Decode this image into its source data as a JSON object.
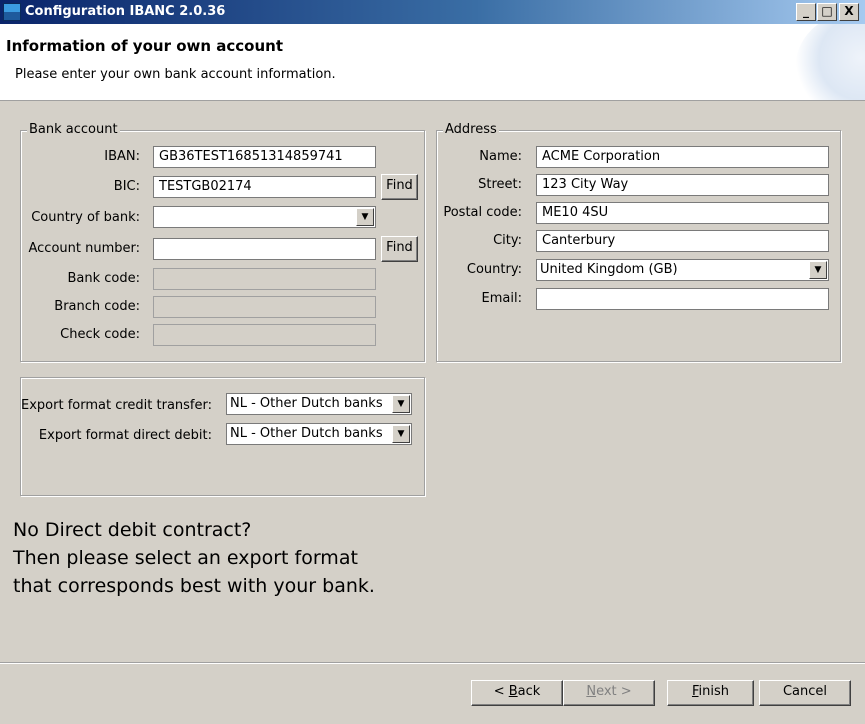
{
  "window": {
    "title": "Configuration IBANC 2.0.36",
    "buttons": {
      "minimize": "_",
      "maximize": "□",
      "close": "X"
    }
  },
  "header": {
    "title": "Information of your own account",
    "subtitle": "Please enter your own bank account information."
  },
  "bank_account": {
    "legend": "Bank account",
    "iban_label": "IBAN:",
    "iban_value": "GB36TEST16851314859741",
    "bic_label": "BIC:",
    "bic_value": "TESTGB02174",
    "find_label": "Find",
    "country_label": "Country of bank:",
    "country_value": "",
    "account_label": "Account number:",
    "account_value": "",
    "bank_code_label": "Bank code:",
    "bank_code_value": "",
    "branch_code_label": "Branch code:",
    "branch_code_value": "",
    "check_code_label": "Check code:",
    "check_code_value": ""
  },
  "address": {
    "legend": "Address",
    "name_label": "Name:",
    "name_value": "ACME Corporation",
    "street_label": "Street:",
    "street_value": "123 City Way",
    "postal_label": "Postal code:",
    "postal_value": "ME10 4SU",
    "city_label": "City:",
    "city_value": "Canterbury",
    "country_label": "Country:",
    "country_value": "United Kingdom (GB)",
    "email_label": "Email:",
    "email_value": ""
  },
  "export": {
    "credit_label": "Export format credit transfer:",
    "credit_value": "NL - Other Dutch banks",
    "debit_label": "Export format direct debit:",
    "debit_value": "NL - Other Dutch banks"
  },
  "info": {
    "line1": "No Direct debit contract?",
    "line2": "Then please select an export format",
    "line3": "that corresponds best with your bank."
  },
  "footer": {
    "back_prefix": "< ",
    "back_key": "B",
    "back_rest": "ack",
    "next_key": "N",
    "next_rest": "ext >",
    "finish_key": "F",
    "finish_rest": "inish",
    "cancel": "Cancel"
  }
}
